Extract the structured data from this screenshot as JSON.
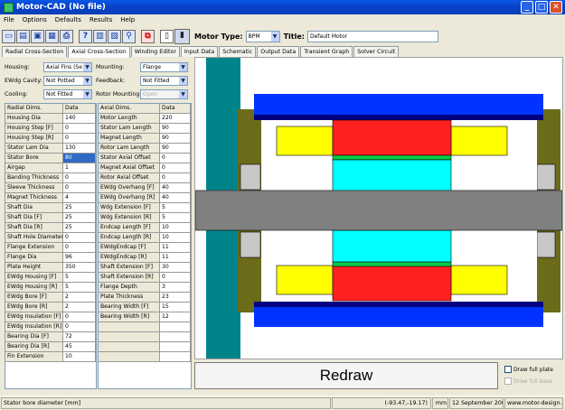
{
  "window": {
    "title": "Motor-CAD (No file)"
  },
  "menu": [
    "File",
    "Options",
    "Defaults",
    "Results",
    "Help"
  ],
  "toolbar": {
    "motor_type_label": "Motor Type:",
    "motor_type_value": "BPM",
    "title_label": "Title:",
    "title_value": "Default Motor"
  },
  "tabs": [
    "Radial Cross-Section",
    "Axial Cross-Section",
    "Winding Editor",
    "Input Data",
    "Schematic",
    "Output Data",
    "Transient Graph",
    "Solver Circuit"
  ],
  "active_tab": "Axial Cross-Section",
  "fields": {
    "housing_label": "Housing:",
    "housing_value": "Axial Fins (Se",
    "mounting_label": "Mounting:",
    "mounting_value": "Flange",
    "ewdg_label": "EWdg Cavity:",
    "ewdg_value": "Not Potted",
    "feedback_label": "Feedback:",
    "feedback_value": "Not Fitted",
    "cooling_label": "Cooling:",
    "cooling_value": "Not Fitted",
    "rotor_mounting_label": "Rotor Mounting:",
    "rotor_mounting_value": "Open"
  },
  "radial_table": {
    "headers": [
      "Radial Dims.",
      "Data"
    ],
    "rows": [
      [
        "Housing Dia",
        "140"
      ],
      [
        "Housing Step [F]",
        "0"
      ],
      [
        "Housing Step [R]",
        "0"
      ],
      [
        "Stator Lam Dia",
        "130"
      ],
      [
        "Stator Bore",
        "80"
      ],
      [
        "Airgap",
        "1"
      ],
      [
        "Banding Thickness",
        "0"
      ],
      [
        "Sleeve Thickness",
        "0"
      ],
      [
        "Magnet Thickness",
        "4"
      ],
      [
        "Shaft Dia",
        "25"
      ],
      [
        "Shaft Dia [F]",
        "25"
      ],
      [
        "Shaft Dia [R]",
        "25"
      ],
      [
        "Shaft Hole Diameter",
        "0"
      ],
      [
        "Flange Extension",
        "0"
      ],
      [
        "Flange Dia",
        "96"
      ],
      [
        "Plate Height",
        "350"
      ],
      [
        "EWdg Housing [F]",
        "5"
      ],
      [
        "EWdg Housing [R]",
        "5"
      ],
      [
        "EWdg Bore [F]",
        "2"
      ],
      [
        "EWdg Bore [R]",
        "2"
      ],
      [
        "EWdg Insulation [F]",
        "0"
      ],
      [
        "EWdg Insulation [R]",
        "0"
      ],
      [
        "Bearing Dia [F]",
        "72"
      ],
      [
        "Bearing Dia [R]",
        "45"
      ],
      [
        "Fin Extension",
        "10"
      ]
    ]
  },
  "axial_table": {
    "headers": [
      "Axial Dims.",
      "Data"
    ],
    "rows": [
      [
        "Motor Length",
        "220"
      ],
      [
        "Stator Lam Length",
        "90"
      ],
      [
        "Magnet Length",
        "90"
      ],
      [
        "Rotor Lam Length",
        "90"
      ],
      [
        "Stator Axial Offset",
        "0"
      ],
      [
        "Magnet Axial Offset",
        "0"
      ],
      [
        "Rotor Axial Offset",
        "0"
      ],
      [
        "EWdg Overhang [F]",
        "40"
      ],
      [
        "EWdg Overhang [R]",
        "40"
      ],
      [
        "Wdg Extension [F]",
        "5"
      ],
      [
        "Wdg Extension [R]",
        "5"
      ],
      [
        "Endcap Length [F]",
        "10"
      ],
      [
        "Endcap Length [R]",
        "10"
      ],
      [
        "EWdgEndcap [F]",
        "11"
      ],
      [
        "EWdgEndcap [R]",
        "11"
      ],
      [
        "Shaft Extension [F]",
        "30"
      ],
      [
        "Shaft Extension [R]",
        "0"
      ],
      [
        "Flange Depth",
        "3"
      ],
      [
        "Plate Thickness",
        "23"
      ],
      [
        "Bearing Width [F]",
        "15"
      ],
      [
        "Bearing Width [R]",
        "12"
      ]
    ],
    "empty_rows": 4
  },
  "selected_cell": "Stator Bore",
  "redraw_label": "Redraw",
  "checkboxes": {
    "draw_full_plate": "Draw full plate",
    "draw_full_base": "Draw full base"
  },
  "status": {
    "hint": "Stator bore diameter [mm]",
    "coords": "(-93.47,-19.17)",
    "unit": "mm",
    "date": "12 September 2006",
    "url": "www.motor-design.com"
  },
  "colors": {
    "teal": "#00848a",
    "blue": "#0033ff",
    "olive": "#6b6b1a",
    "yellow": "#ffff00",
    "red": "#ff2020",
    "green": "#00cc44",
    "cyan": "#00ffff",
    "gray": "#808080",
    "lightgray": "#c8c8c8",
    "navy": "#000080"
  },
  "icons": [
    "new-file-icon",
    "open-icon",
    "save-icon",
    "save-as-icon",
    "print-icon",
    "help-icon",
    "calculator-icon",
    "motor-info-icon",
    "link-icon",
    "copy-icon",
    "motor-type-icon"
  ]
}
